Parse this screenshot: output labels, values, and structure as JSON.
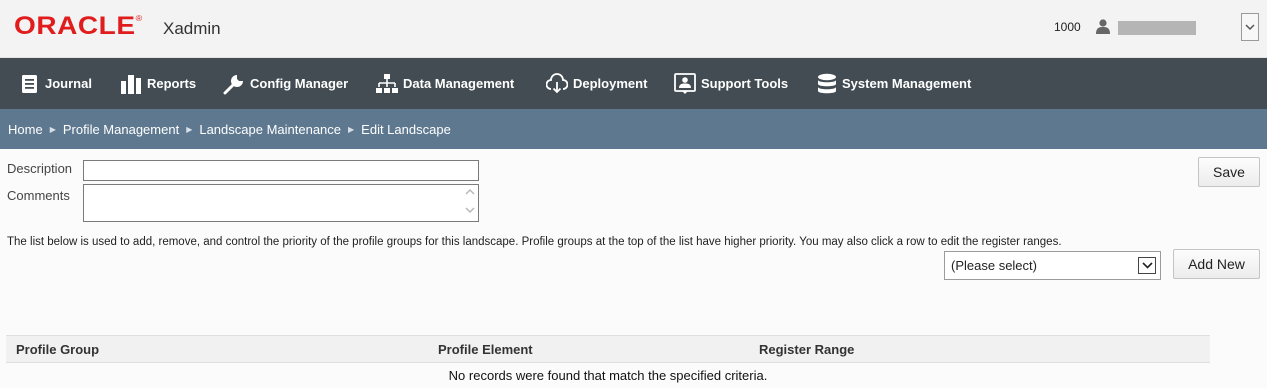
{
  "header": {
    "logo": "ORACLE",
    "logo_mark": "®",
    "app_name": "Xadmin",
    "store_id": "1000"
  },
  "nav": {
    "items": [
      {
        "label": "Journal",
        "icon": "journal-icon"
      },
      {
        "label": "Reports",
        "icon": "bar-chart-icon"
      },
      {
        "label": "Config Manager",
        "icon": "wrench-icon"
      },
      {
        "label": "Data Management",
        "icon": "hierarchy-icon"
      },
      {
        "label": "Deployment",
        "icon": "cloud-download-icon"
      },
      {
        "label": "Support Tools",
        "icon": "support-icon"
      },
      {
        "label": "System Management",
        "icon": "database-icon"
      }
    ]
  },
  "breadcrumb": [
    "Home",
    "Profile Management",
    "Landscape Maintenance",
    "Edit Landscape"
  ],
  "form": {
    "description_label": "Description",
    "description_value": "",
    "comments_label": "Comments",
    "comments_value": "",
    "save_label": "Save",
    "info_text": "The list below is used to add, remove, and control the priority of the profile groups for this landscape. Profile groups at the top of the list have higher priority. You may also click a row to edit the register ranges.",
    "select_value": "(Please select)",
    "add_new_label": "Add New"
  },
  "table": {
    "columns": [
      "Profile Group",
      "Profile Element",
      "Register Range"
    ],
    "empty_message": "No records were found that match the specified criteria."
  },
  "colors": {
    "brand_red": "#e01c1c",
    "nav_bg": "#424c52",
    "breadcrumb_bg": "#5e7890"
  }
}
